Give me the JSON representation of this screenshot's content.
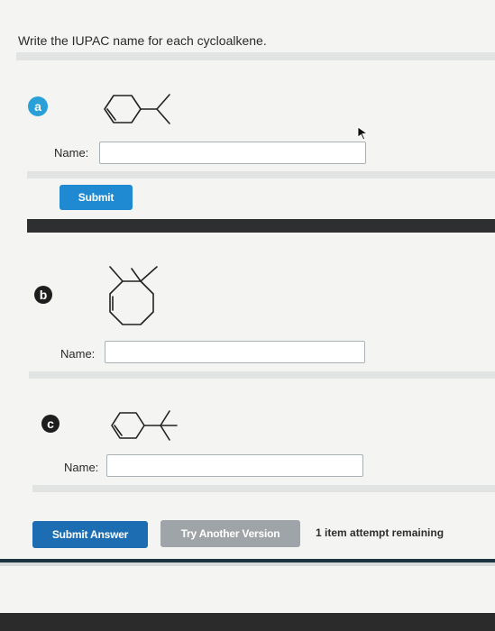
{
  "instruction": "Write the IUPAC name for each cycloalkene.",
  "questions": [
    {
      "badge": "a",
      "name_label": "Name:",
      "name_value": "",
      "submit_label": "Submit",
      "badge_color": "#2aa0d8"
    },
    {
      "badge": "b",
      "name_label": "Name:",
      "name_value": "",
      "badge_color": "#1e1e1e"
    },
    {
      "badge": "c",
      "name_label": "Name:",
      "name_value": "",
      "badge_color": "#1e1e1e"
    }
  ],
  "footer": {
    "submit_answer_label": "Submit Answer",
    "try_another_label": "Try Another Version",
    "attempts_text": "1 item attempt remaining"
  }
}
